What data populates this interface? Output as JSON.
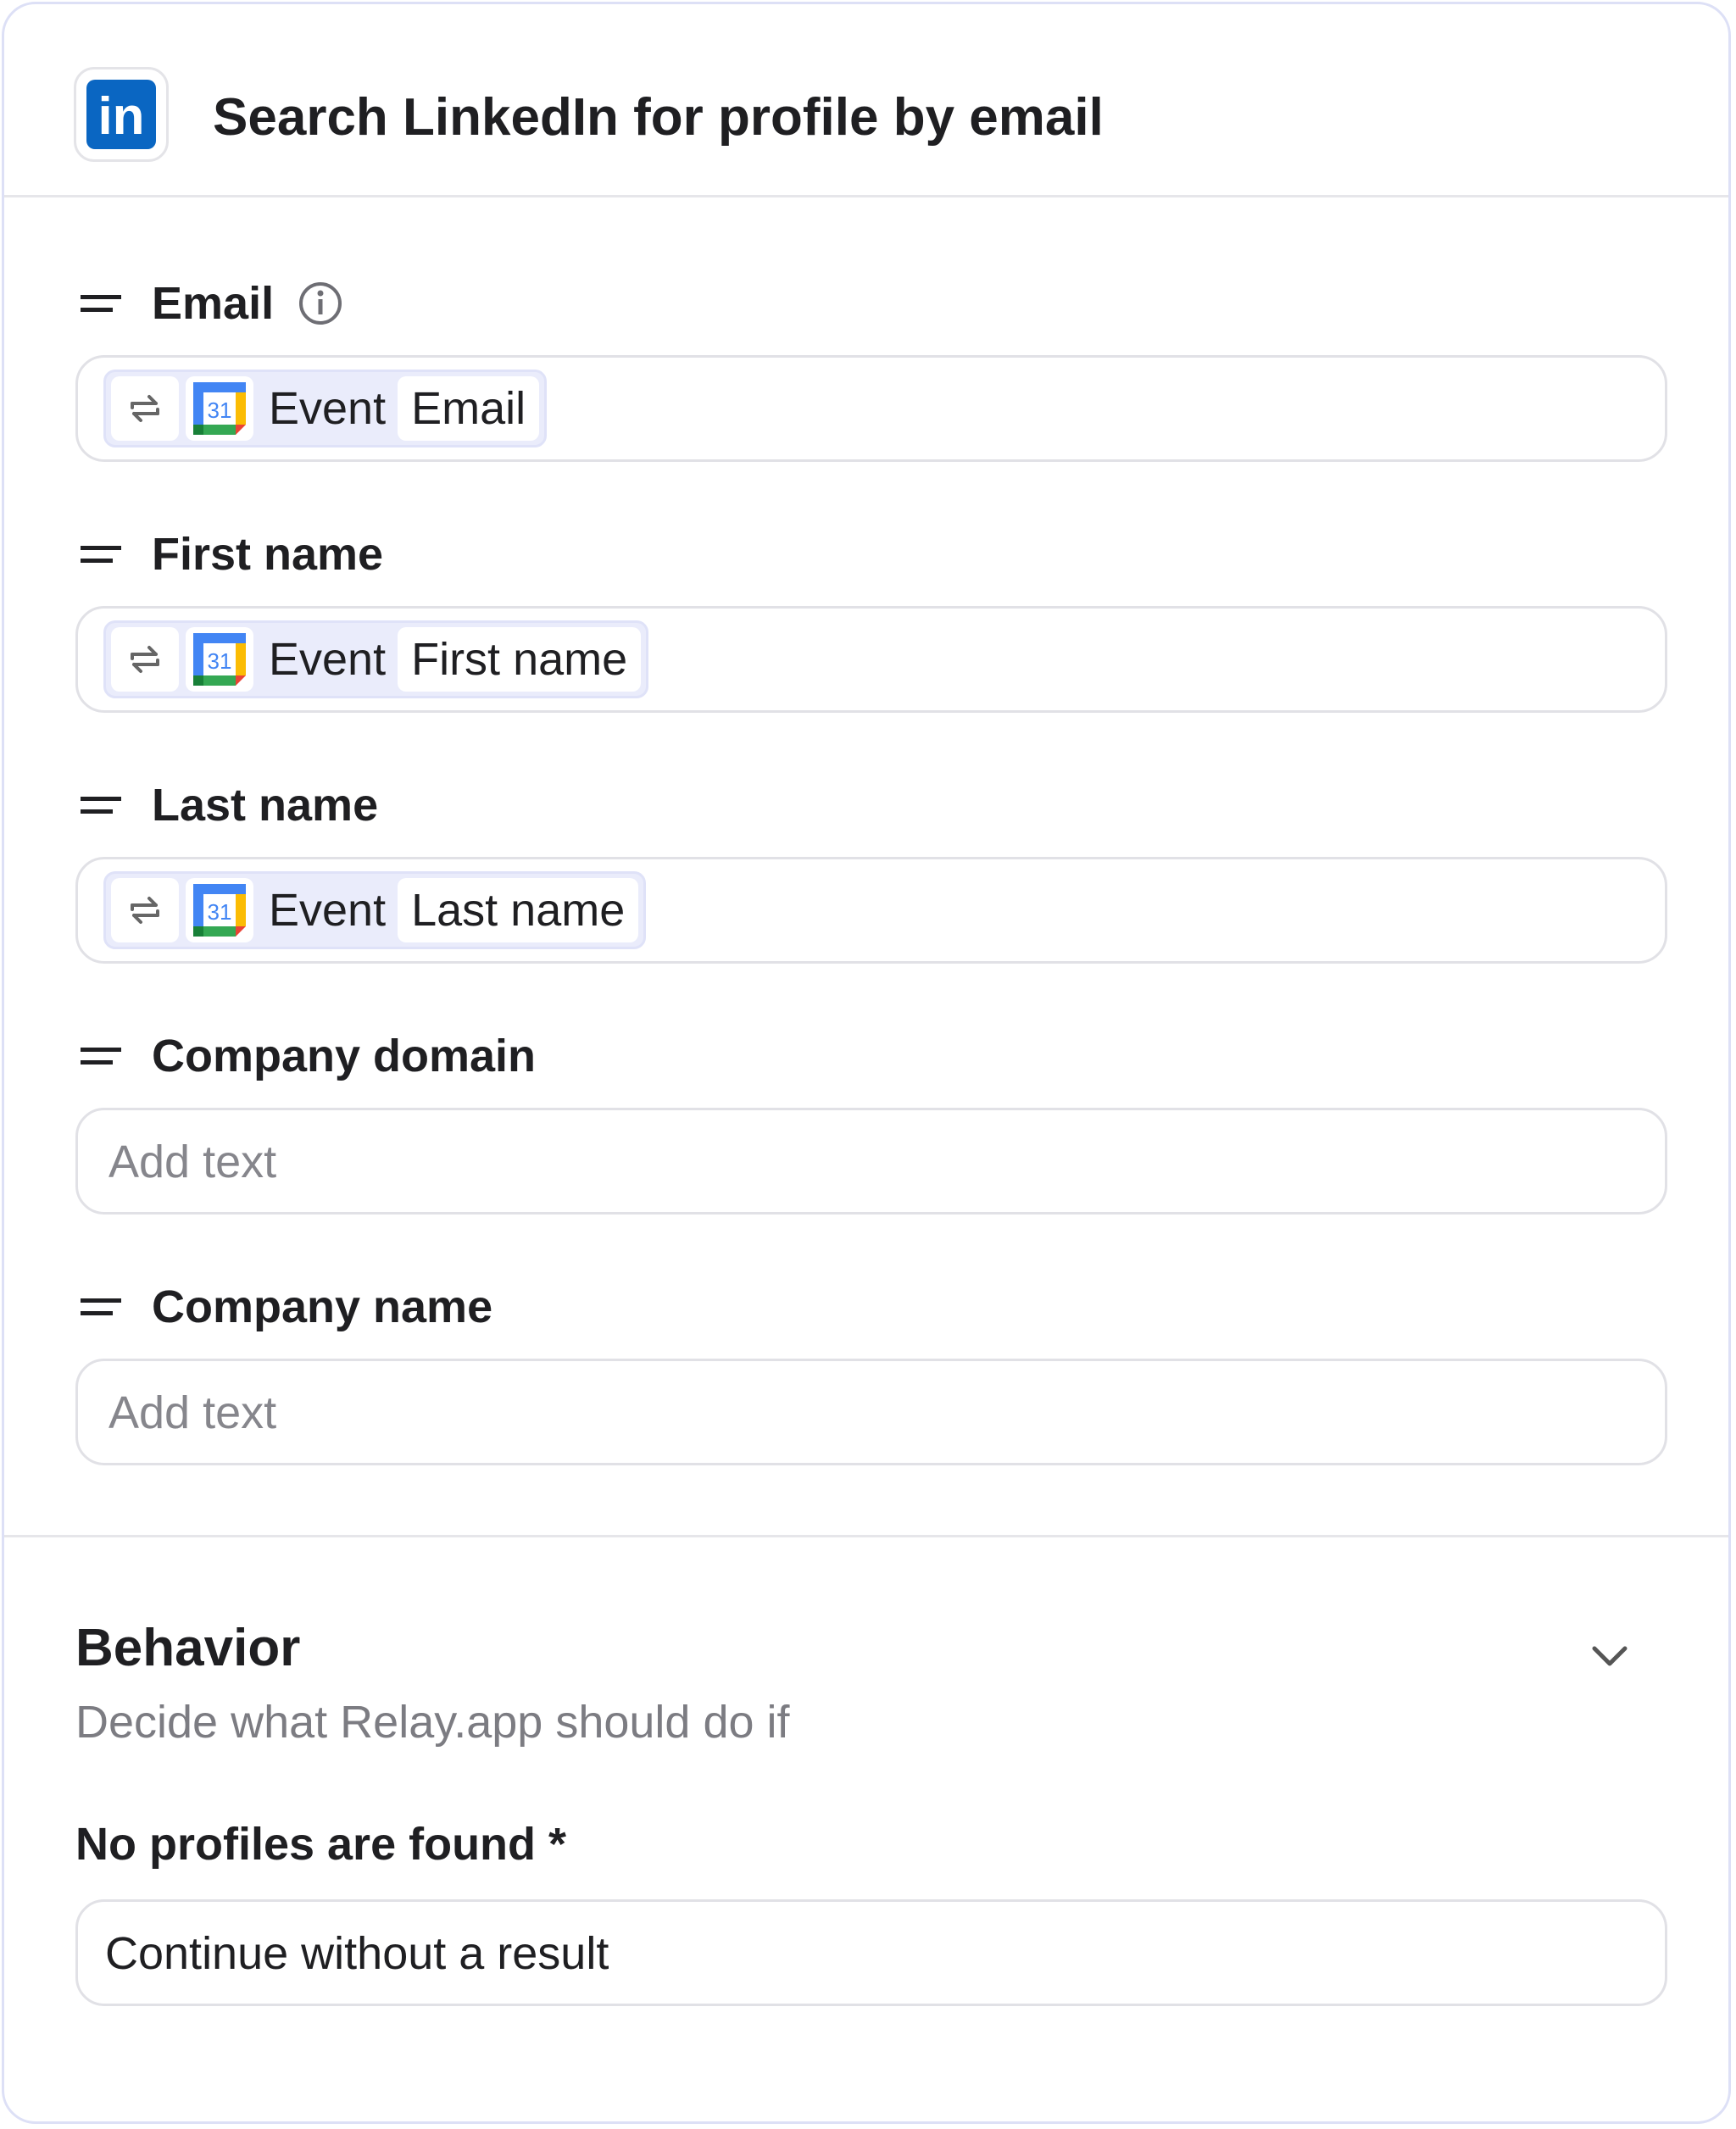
{
  "header": {
    "title": "Search LinkedIn for profile by email",
    "app_icon": "linkedin-icon",
    "app_icon_text": "in"
  },
  "fields": [
    {
      "label": "Email",
      "has_info": true,
      "token": {
        "source": "Event",
        "field": "Email",
        "app_icon": "google-calendar-icon",
        "icon_text": "31"
      }
    },
    {
      "label": "First name",
      "token": {
        "source": "Event",
        "field": "First name",
        "app_icon": "google-calendar-icon",
        "icon_text": "31"
      }
    },
    {
      "label": "Last name",
      "token": {
        "source": "Event",
        "field": "Last name",
        "app_icon": "google-calendar-icon",
        "icon_text": "31"
      }
    },
    {
      "label": "Company domain",
      "placeholder": "Add text"
    },
    {
      "label": "Company name",
      "placeholder": "Add text"
    }
  ],
  "behavior": {
    "title": "Behavior",
    "subtitle": "Decide what Relay.app should do if",
    "no_profiles_label": "No profiles are found *",
    "no_profiles_value": "Continue without a result"
  },
  "colors": {
    "linkedin_blue": "#0a66c2",
    "chip_background": "#eaecfb",
    "panel_border": "#dde0f6",
    "placeholder_text": "#86868c"
  }
}
